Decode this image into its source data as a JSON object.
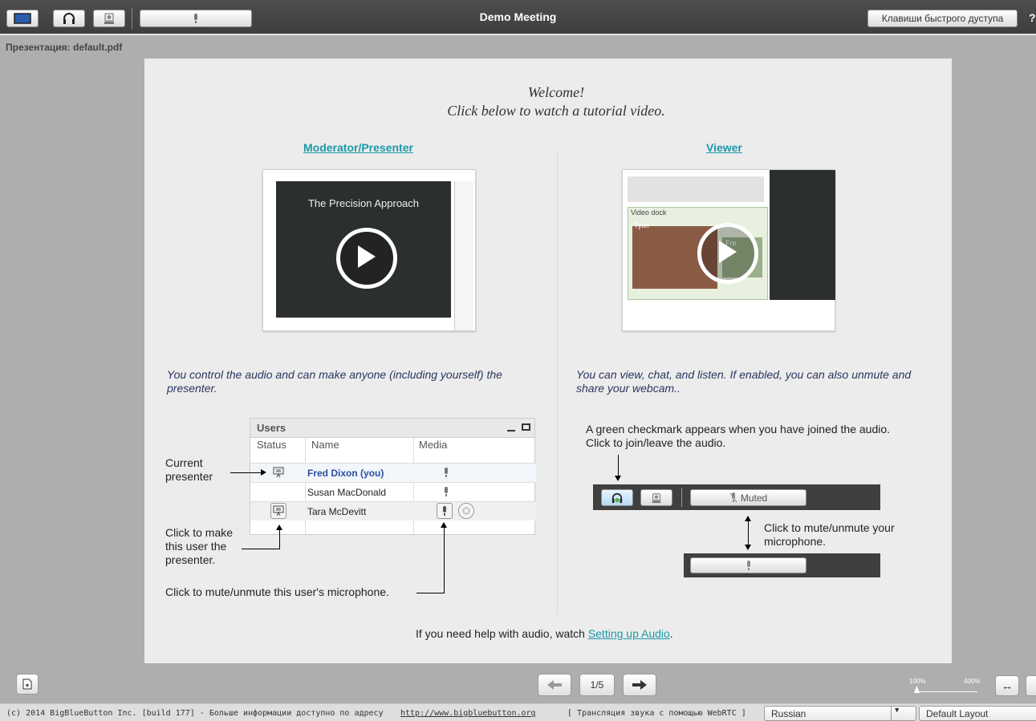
{
  "topbar": {
    "title": "Demo Meeting",
    "shortcuts_label": "Клавиши быстрого дуступа",
    "help_label": "?"
  },
  "presentation_label": "Презентация: default.pdf",
  "slide": {
    "welcome_line1": "Welcome!",
    "welcome_line2": "Click below to watch a tutorial video.",
    "moderator_link": "Moderator/Presenter",
    "viewer_link": "Viewer",
    "mod_thumb_title": "The Precision Approach",
    "viewer_thumb_dock": "Video dock",
    "viewer_thumb_name": "Tyler",
    "viewer_thumb_name2": "Fre",
    "mod_desc": "You control the audio and can make anyone (including yourself) the presenter.",
    "viewer_desc": "You can view, chat, and listen.  If enabled, you can also unmute and share your webcam..",
    "users_panel": {
      "title": "Users",
      "col_status": "Status",
      "col_name": "Name",
      "col_media": "Media",
      "rows": [
        {
          "name": "Fred Dixon (you)"
        },
        {
          "name": "Susan MacDonald"
        },
        {
          "name": "Tara McDevitt"
        }
      ]
    },
    "current_presenter_label": "Current presenter",
    "click_make_presenter": "Click to make this user the presenter.",
    "click_mute_user": "Click to mute/unmute this user's microphone.",
    "green_check_text": "A green checkmark appears when you have joined the audio.  Click to join/leave the audio.",
    "muted_label": "Muted",
    "click_mute_mic": "Click to mute/unmute your microphone.",
    "help_prefix": "If you need help with audio, watch ",
    "help_link": "Setting up Audio",
    "help_suffix": "."
  },
  "controls": {
    "page_indicator": "1/5",
    "zoom_min": "100%",
    "zoom_max": "400%"
  },
  "footer": {
    "copyright": "(c) 2014 BigBlueButton Inc. [build 177] - Больше информации доступно по адресу ",
    "link": "http://www.bigbluebutton.org",
    "webrtc": "[ Трансляция звука с помощью WebRTC ]",
    "language": "Russian",
    "layout": "Default Layout"
  },
  "colors": {
    "accent_link": "#1a99a9",
    "topbar": "#444444",
    "slide_bg": "#ececec"
  },
  "icons": [
    "desktop-icon",
    "headset-icon",
    "webcam-icon",
    "microphone-icon",
    "presenter-icon",
    "play-icon",
    "upload-icon",
    "arrow-left-icon",
    "arrow-right-icon",
    "fit-width-icon",
    "dropdown-arrow-icon"
  ]
}
